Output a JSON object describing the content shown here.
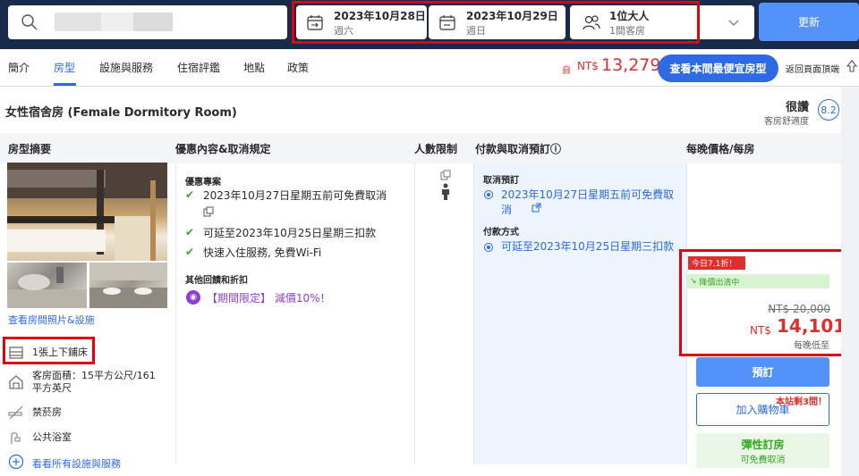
{
  "search": {
    "placeholder": ""
  },
  "dates": {
    "checkin": {
      "date": "2023年10月28日",
      "weekday": "週六"
    },
    "checkout": {
      "date": "2023年10月29日",
      "weekday": "週日"
    }
  },
  "guests": {
    "adults": "1位大人",
    "rooms": "1間客房"
  },
  "update_label": "更新",
  "nav": {
    "tabs": [
      "簡介",
      "房型",
      "設施與服務",
      "住宿評鑑",
      "地點",
      "政策"
    ],
    "from_label": "自",
    "from_currency": "NT$",
    "from_price": "13,279",
    "cheapest_button": "查看本間最便宜房型",
    "back_to_top": "返回頁面頂端"
  },
  "room": {
    "title": "女性宿舍房 (Female Dormitory Room)",
    "rating_word": "很讚",
    "rating_sub": "客房舒適度",
    "rating_score": "8.2"
  },
  "columns": [
    "房型摘要",
    "優惠內容&取消規定",
    "人數限制",
    "付款與取消預訂ⓘ",
    "每晚價格/每房"
  ],
  "summary": {
    "photos_link": "查看房間照片&設施",
    "amenities": [
      {
        "icon": "bunk-bed-icon",
        "text": "1張上下鋪床"
      },
      {
        "icon": "room-size-icon",
        "text": "客房面積：15平方公尺/161平方英尺"
      },
      {
        "icon": "no-smoking-icon",
        "text": "禁菸房"
      },
      {
        "icon": "shower-icon",
        "text": "公共浴室"
      }
    ],
    "all_amenities_link": "看看所有設施與服務"
  },
  "offer": {
    "title": "優惠專案",
    "benefits": [
      "2023年10月27日星期五前可免費取消",
      "可延至2023年10月25日星期三扣款",
      "快速入住服務, 免費Wi-Fi"
    ],
    "other_title": "其他回饋和折扣",
    "promo": "【期間限定】 減價10%！"
  },
  "payment": {
    "cancel_title": "取消預訂",
    "cancel_text": "2023年10月27日星期五前可免費取消",
    "pay_title": "付款方式",
    "pay_text": "可延至2023年10月25日星期三扣款"
  },
  "price": {
    "discount_badge": "今日7.1折！",
    "price_drop": "降價出清中",
    "old_price": "NT$ 20,000",
    "currency": "NT$",
    "new_price": "14,101",
    "per_night": "每晚低至",
    "book_button": "預訂",
    "cart_button": "加入購物車",
    "flex_title": "彈性訂房",
    "flex_sub": "可免費取消",
    "rooms_left": "本站剩3間！"
  },
  "colors": {
    "accent": "#2d6ae3",
    "header": "#1a2b49",
    "price": "#e12d2d",
    "highlight": "#e0000f"
  }
}
